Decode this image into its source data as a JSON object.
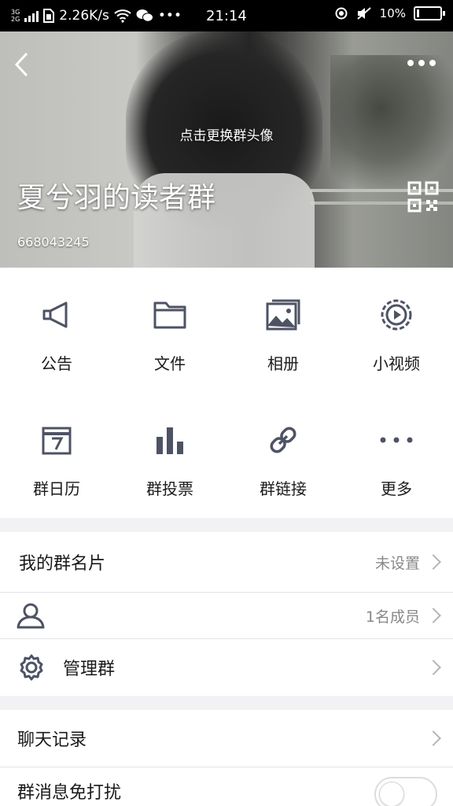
{
  "status_bar": {
    "network_top": "3G",
    "network_bottom": "2G",
    "speed": "2.26K/s",
    "dots": "•••",
    "time": "21:14",
    "battery": "10%",
    "battery_level": 0.1
  },
  "header": {
    "change_avatar": "点击更换群头像",
    "group_name": "夏兮羽的读者群",
    "group_id": "668043245"
  },
  "features": [
    {
      "label": "公告",
      "icon": "megaphone-icon"
    },
    {
      "label": "文件",
      "icon": "folder-icon"
    },
    {
      "label": "相册",
      "icon": "photo-album-icon"
    },
    {
      "label": "小视频",
      "icon": "video-play-icon"
    },
    {
      "label": "群日历",
      "icon": "calendar-icon"
    },
    {
      "label": "群投票",
      "icon": "bar-chart-icon"
    },
    {
      "label": "群链接",
      "icon": "link-icon"
    },
    {
      "label": "更多",
      "icon": "more-dots-icon"
    }
  ],
  "settings": {
    "card_label": "我的群名片",
    "card_value": "未设置",
    "members_value": "1名成员",
    "manage_label": "管理群",
    "chat_history_label": "聊天记录",
    "mute_label": "群消息免打扰",
    "mute_on": false
  },
  "colors": {
    "icon": "#4e5364",
    "secondary_text": "#888888"
  }
}
